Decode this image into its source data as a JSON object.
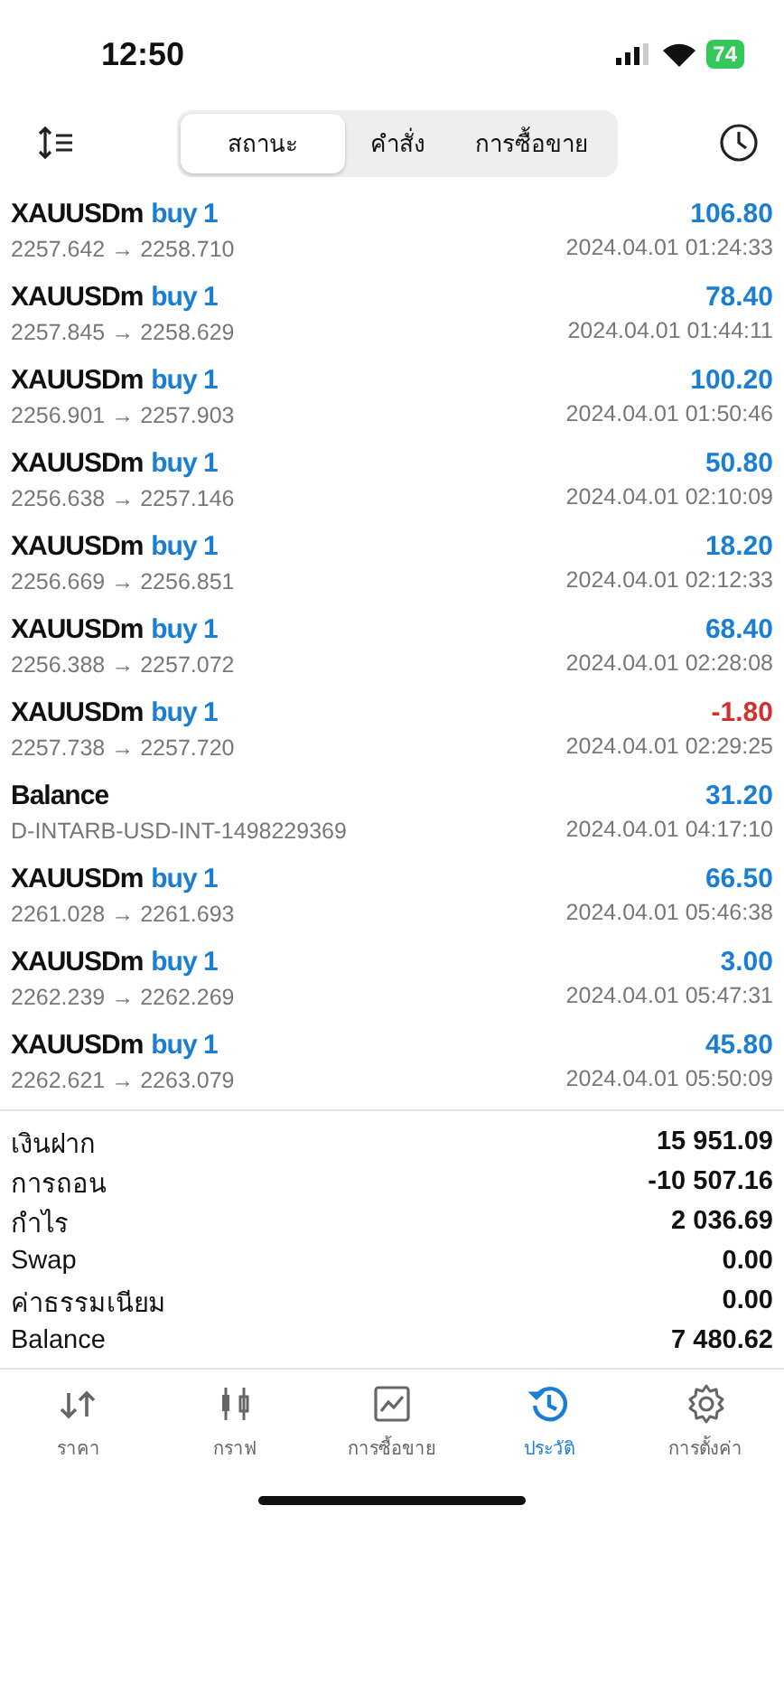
{
  "status_bar": {
    "time": "12:50",
    "battery": "74"
  },
  "segments": [
    {
      "label": "สถานะ",
      "selected": true
    },
    {
      "label": "คำสั่ง",
      "selected": false
    },
    {
      "label": "การซื้อขาย",
      "selected": false
    }
  ],
  "deals": [
    {
      "kind": "trade",
      "symbol": "XAUUSDm",
      "side": "buy 1",
      "prices": "2257.642 → 2258.710",
      "time": "2024.04.01 01:24:33",
      "profit": "106.80",
      "loss": false
    },
    {
      "kind": "trade",
      "symbol": "XAUUSDm",
      "side": "buy 1",
      "prices": "2257.845 → 2258.629",
      "time": "2024.04.01 01:44:11",
      "profit": "78.40",
      "loss": false
    },
    {
      "kind": "trade",
      "symbol": "XAUUSDm",
      "side": "buy 1",
      "prices": "2256.901 → 2257.903",
      "time": "2024.04.01 01:50:46",
      "profit": "100.20",
      "loss": false
    },
    {
      "kind": "trade",
      "symbol": "XAUUSDm",
      "side": "buy 1",
      "prices": "2256.638 → 2257.146",
      "time": "2024.04.01 02:10:09",
      "profit": "50.80",
      "loss": false
    },
    {
      "kind": "trade",
      "symbol": "XAUUSDm",
      "side": "buy 1",
      "prices": "2256.669 → 2256.851",
      "time": "2024.04.01 02:12:33",
      "profit": "18.20",
      "loss": false
    },
    {
      "kind": "trade",
      "symbol": "XAUUSDm",
      "side": "buy 1",
      "prices": "2256.388 → 2257.072",
      "time": "2024.04.01 02:28:08",
      "profit": "68.40",
      "loss": false
    },
    {
      "kind": "trade",
      "symbol": "XAUUSDm",
      "side": "buy 1",
      "prices": "2257.738 → 2257.720",
      "time": "2024.04.01 02:29:25",
      "profit": "-1.80",
      "loss": true
    },
    {
      "kind": "balance",
      "symbol": "Balance",
      "prices": "D-INTARB-USD-INT-1498229369",
      "time": "2024.04.01 04:17:10",
      "profit": "31.20",
      "loss": false
    },
    {
      "kind": "trade",
      "symbol": "XAUUSDm",
      "side": "buy 1",
      "prices": "2261.028 → 2261.693",
      "time": "2024.04.01 05:46:38",
      "profit": "66.50",
      "loss": false
    },
    {
      "kind": "trade",
      "symbol": "XAUUSDm",
      "side": "buy 1",
      "prices": "2262.239 → 2262.269",
      "time": "2024.04.01 05:47:31",
      "profit": "3.00",
      "loss": false
    },
    {
      "kind": "trade",
      "symbol": "XAUUSDm",
      "side": "buy 1",
      "prices": "2262.621 → 2263.079",
      "time": "2024.04.01 05:50:09",
      "profit": "45.80",
      "loss": false
    }
  ],
  "summary": [
    {
      "label": "เงินฝาก",
      "value": "15 951.09"
    },
    {
      "label": "การถอน",
      "value": "-10 507.16"
    },
    {
      "label": "กำไร",
      "value": "2 036.69"
    },
    {
      "label": "Swap",
      "value": "0.00"
    },
    {
      "label": "ค่าธรรมเนียม",
      "value": "0.00"
    },
    {
      "label": "Balance",
      "value": "7 480.62"
    }
  ],
  "tab_bar": [
    {
      "kind": "quotes",
      "label": "ราคา",
      "selected": false
    },
    {
      "kind": "chart",
      "label": "กราฟ",
      "selected": false
    },
    {
      "kind": "trade",
      "label": "การซื้อขาย",
      "selected": false
    },
    {
      "kind": "history",
      "label": "ประวัติ",
      "selected": true
    },
    {
      "kind": "settings",
      "label": "การตั้งค่า",
      "selected": false
    }
  ]
}
